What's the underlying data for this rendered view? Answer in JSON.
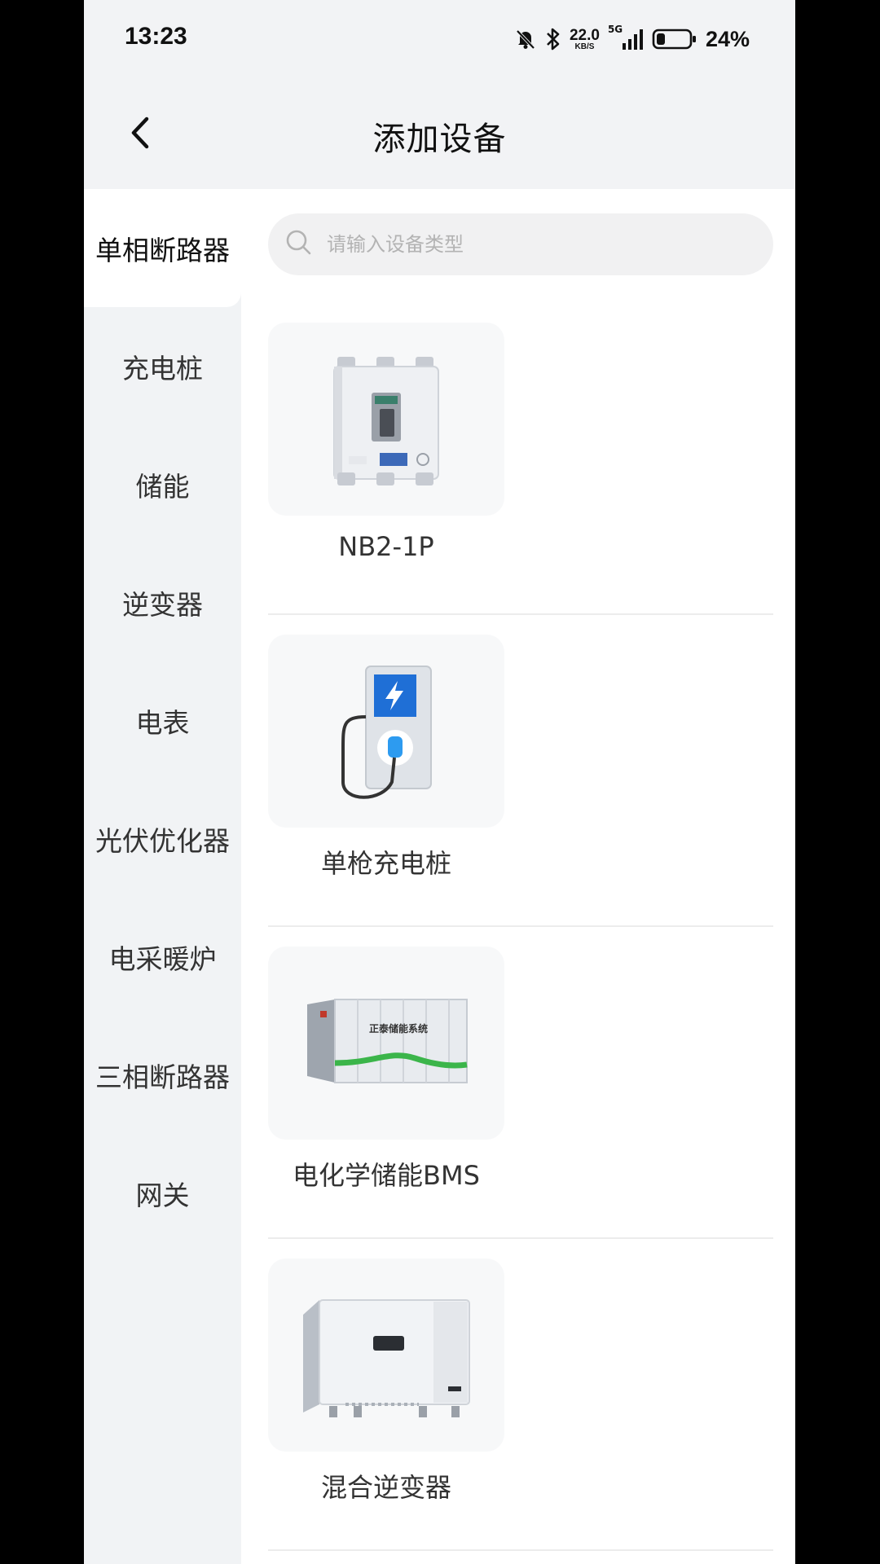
{
  "status_bar": {
    "time": "13:23",
    "speed_value": "22.0",
    "speed_unit": "KB/S",
    "network": "5G",
    "battery_percent": "24%",
    "icons": [
      "bell-mute-icon",
      "bluetooth-icon",
      "signal-icon",
      "battery-icon"
    ]
  },
  "header": {
    "title": "添加设备",
    "back_icon": "chevron-left-icon"
  },
  "sidebar": {
    "active_index": 0,
    "items": [
      {
        "label": "单相断路器"
      },
      {
        "label": "充电桩"
      },
      {
        "label": "储能"
      },
      {
        "label": "逆变器"
      },
      {
        "label": "电表"
      },
      {
        "label": "光伏优化器"
      },
      {
        "label": "电采暖炉"
      },
      {
        "label": "三相断路器"
      },
      {
        "label": "网关"
      }
    ]
  },
  "search": {
    "placeholder": "请输入设备类型",
    "value": "",
    "icon": "search-icon"
  },
  "devices": [
    {
      "name": "NB2-1P",
      "image": "circuit-breaker-image"
    },
    {
      "name": "单枪充电桩",
      "image": "charging-pile-image"
    },
    {
      "name": "电化学储能BMS",
      "image": "energy-storage-container-image",
      "image_text": "正泰储能系统"
    },
    {
      "name": "混合逆变器",
      "image": "hybrid-inverter-image"
    }
  ],
  "colors": {
    "sidebar_bg": "#f1f3f5",
    "header_bg": "#f2f3f5",
    "accent_green": "#3bb54a",
    "charger_blue": "#1e88e5"
  }
}
